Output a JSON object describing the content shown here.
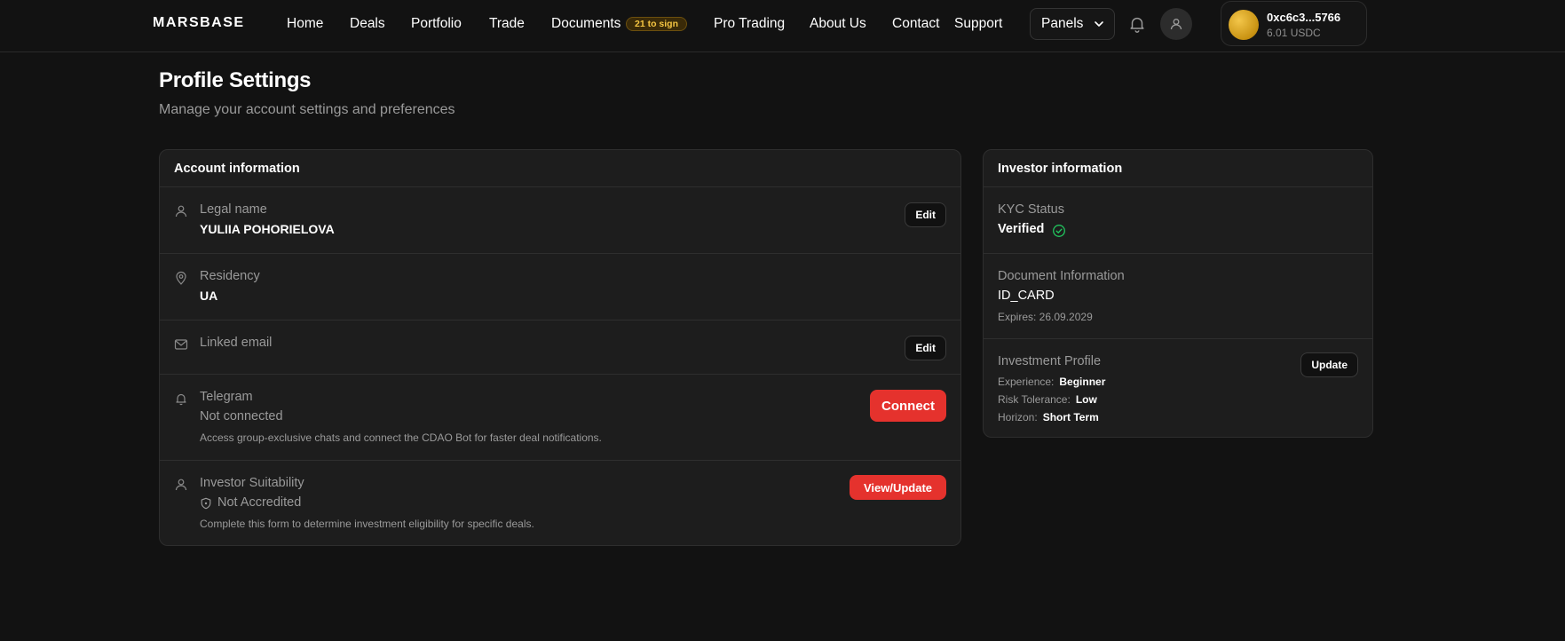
{
  "header": {
    "logo": "MARSBASE",
    "nav": [
      {
        "label": "Home"
      },
      {
        "label": "Deals"
      },
      {
        "label": "Portfolio"
      },
      {
        "label": "Trade"
      },
      {
        "label": "Documents"
      },
      {
        "label": "Pro Trading"
      },
      {
        "label": "About Us"
      },
      {
        "label": "Contact"
      },
      {
        "label": "Support"
      }
    ],
    "documents_badge": "21 to sign",
    "panels_label": "Panels",
    "wallet": {
      "address": "0xc6c3...5766",
      "balance": "6.01 USDC"
    }
  },
  "page": {
    "title": "Profile Settings",
    "subtitle": "Manage your account settings and preferences"
  },
  "account": {
    "heading": "Account information",
    "legal_name": {
      "label": "Legal name",
      "value": "YULIIA POHORIELOVA",
      "button": "Edit"
    },
    "residency": {
      "label": "Residency",
      "value": "UA"
    },
    "email": {
      "label": "Linked email",
      "button": "Edit"
    },
    "telegram": {
      "label": "Telegram",
      "status": "Not connected",
      "note": "Access group-exclusive chats and connect the CDAO Bot for faster deal notifications.",
      "button": "Connect"
    },
    "suitability": {
      "label": "Investor Suitability",
      "status": "Not Accredited",
      "note": "Complete this form to determine investment eligibility for specific deals.",
      "button": "View/Update"
    }
  },
  "investor": {
    "heading": "Investor information",
    "kyc": {
      "label": "KYC Status",
      "value": "Verified"
    },
    "document": {
      "label": "Document Information",
      "value": "ID_CARD",
      "expires": "Expires: 26.09.2029"
    },
    "profile": {
      "label": "Investment Profile",
      "button": "Update",
      "experience_label": "Experience:",
      "experience": "Beginner",
      "risk_label": "Risk Tolerance:",
      "risk": "Low",
      "horizon_label": "Horizon:",
      "horizon": "Short Term"
    }
  },
  "colors": {
    "accent_red": "#e5322d",
    "verified_green": "#22c55e",
    "badge_gold": "#f5c542"
  }
}
